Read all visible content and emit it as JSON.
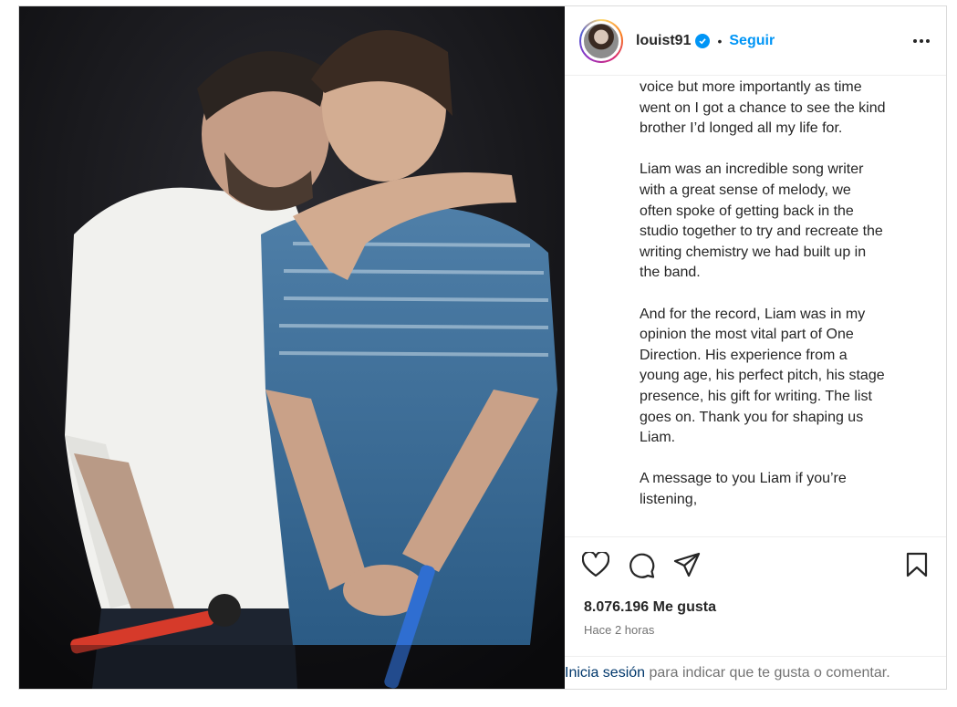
{
  "post": {
    "username": "louist91",
    "separator": "•",
    "follow_label": "Seguir",
    "caption_paragraphs": [
      "voice but more importantly as time\nwent on I got a chance to see the kind\nbrother I’d longed all my life for.",
      "Liam was an incredible song writer\nwith a great sense of melody, we\noften spoke of getting back in the\nstudio together to try and recreate the\nwriting chemistry we had built up in\nthe band.",
      "And for the record, Liam was in my\nopinion the most vital part of One\nDirection. His experience from a\nyoung age, his perfect pitch, his stage\npresence, his gift for writing. The list\ngoes on. Thank you for shaping us\nLiam.",
      "A message to you Liam if you’re\nlistening,"
    ],
    "likes": "8.076.196 Me gusta",
    "timestamp": "Hace 2 horas",
    "login_link": "Inicia sesión",
    "login_rest": " para indicar que te gusta o comentar."
  },
  "icons": {
    "verified": "verified-badge-icon",
    "more": "more-options-icon",
    "like": "heart-icon",
    "comment": "comment-icon",
    "share": "share-icon",
    "save": "bookmark-icon"
  },
  "colors": {
    "accent": "#0095f6",
    "text": "#262626",
    "muted": "#737373",
    "link": "#00376b"
  }
}
